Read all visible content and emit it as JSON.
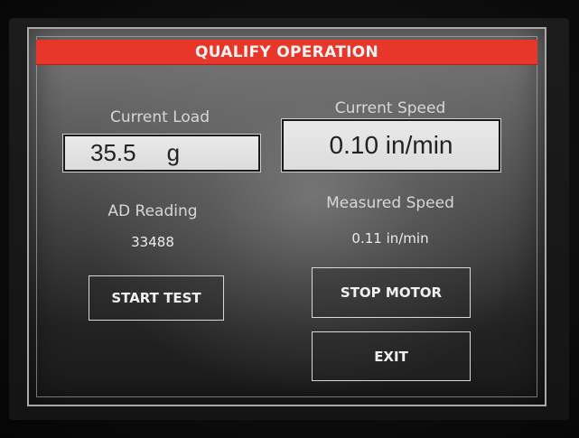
{
  "screen": {
    "title": "QUALIFY OPERATION"
  },
  "current_load": {
    "label": "Current Load",
    "value": "35.5",
    "unit": "g"
  },
  "current_speed": {
    "label": "Current Speed",
    "value": "0.10 in/min"
  },
  "ad_reading": {
    "label": "AD Reading",
    "value": "33488"
  },
  "measured_speed": {
    "label": "Measured Speed",
    "value": "0.11 in/min"
  },
  "buttons": {
    "start_test": "START TEST",
    "stop_motor": "STOP MOTOR",
    "exit": "EXIT"
  },
  "colors": {
    "title_bar": "#e8362a",
    "screen_border": "#a9a9a9",
    "value_box": "#e4e4e4"
  }
}
